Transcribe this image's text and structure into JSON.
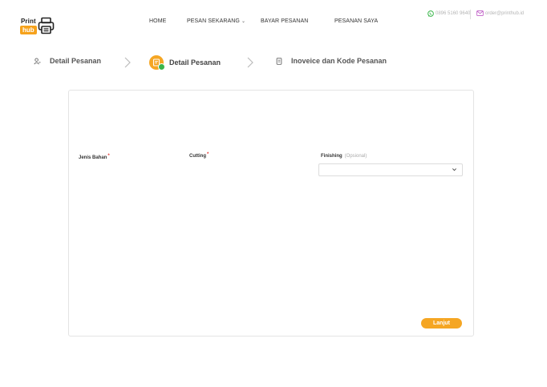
{
  "brand": {
    "word1": "Print",
    "word2": "hub",
    "accent": "#f5a623"
  },
  "nav": {
    "home": "HOME",
    "order_now": "PESAN SEKARANG",
    "pay": "BAYAR PESANAN",
    "my_orders": "PESANAN SAYA"
  },
  "contact": {
    "phone": "0896 5160 9640",
    "email": "order@printhub.id",
    "phone_icon": "whatsapp-icon",
    "email_icon": "mail-icon"
  },
  "steps": [
    {
      "label": "Detail Pesanan",
      "icon": "user-icon",
      "state": "done"
    },
    {
      "label": "Detail Pesanan",
      "icon": "document-check-icon",
      "state": "active"
    },
    {
      "label": "Inoveice dan Kode Pesanan",
      "icon": "invoice-icon",
      "state": "pending"
    }
  ],
  "form": {
    "material_label": "Jenis Bahan",
    "cutting_label": "Cutting",
    "finishing_label": "Finishing",
    "finishing_optional": "(Opsional)",
    "required_mark": "*",
    "finishing_value": ""
  },
  "actions": {
    "next_label": "Lanjut"
  },
  "colors": {
    "accent": "#f5a623",
    "success": "#3ab54a",
    "required": "#e53935"
  }
}
